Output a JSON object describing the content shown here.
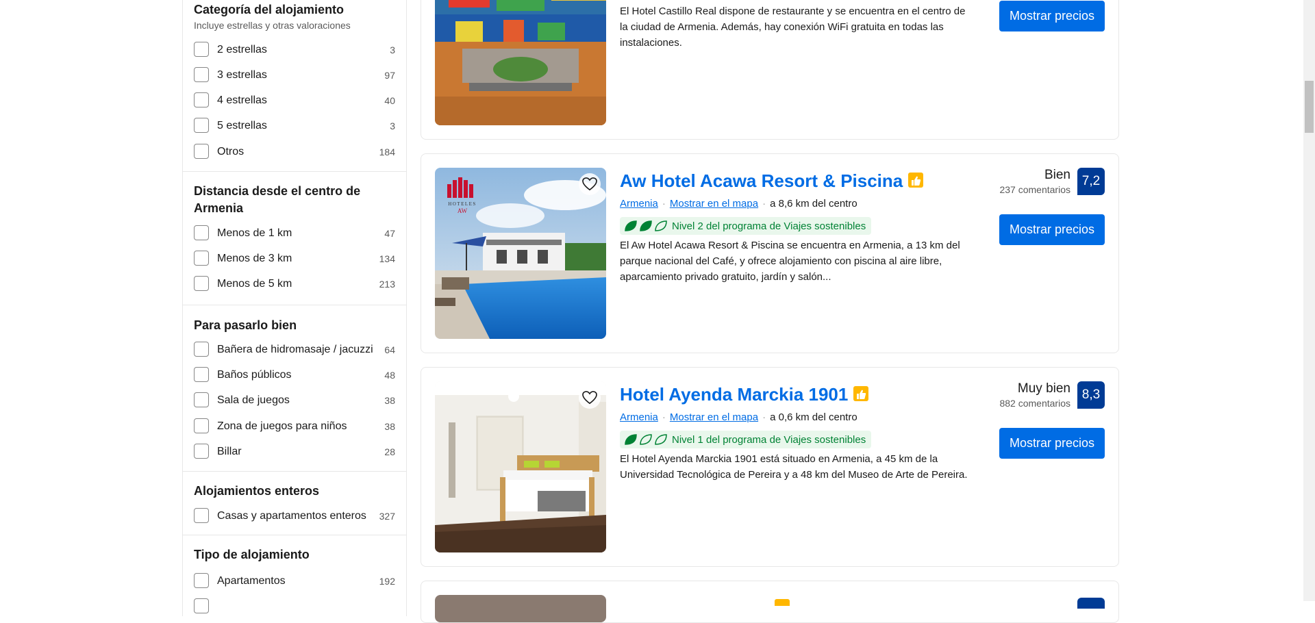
{
  "filters": {
    "category": {
      "title": "Categoría del alojamiento",
      "subtitle": "Incluye estrellas y otras valoraciones",
      "items": [
        {
          "label": "2 estrellas",
          "count": "3"
        },
        {
          "label": "3 estrellas",
          "count": "97"
        },
        {
          "label": "4 estrellas",
          "count": "40"
        },
        {
          "label": "5 estrellas",
          "count": "3"
        },
        {
          "label": "Otros",
          "count": "184"
        }
      ]
    },
    "distance": {
      "title": "Distancia desde el centro de Armenia",
      "items": [
        {
          "label": "Menos de 1 km",
          "count": "47"
        },
        {
          "label": "Menos de 3 km",
          "count": "134"
        },
        {
          "label": "Menos de 5 km",
          "count": "213"
        }
      ]
    },
    "fun": {
      "title": "Para pasarlo bien",
      "items": [
        {
          "label": "Bañera de hidromasaje / jacuzzi",
          "count": "64"
        },
        {
          "label": "Baños públicos",
          "count": "48"
        },
        {
          "label": "Sala de juegos",
          "count": "38"
        },
        {
          "label": "Zona de juegos para niños",
          "count": "38"
        },
        {
          "label": "Billar",
          "count": "28"
        }
      ]
    },
    "entire": {
      "title": "Alojamientos enteros",
      "items": [
        {
          "label": "Casas y apartamentos enteros",
          "count": "327"
        }
      ]
    },
    "type": {
      "title": "Tipo de alojamiento",
      "items": [
        {
          "label": "Apartamentos",
          "count": "192"
        }
      ]
    }
  },
  "results": [
    {
      "description": "El Hotel Castillo Real dispone de restaurante y se encuentra en el centro de la ciudad de Armenia. Además, hay conexión WiFi gratuita en todas las instalaciones.",
      "cta": "Mostrar precios"
    },
    {
      "name": "Aw Hotel Acawa Resort & Piscina",
      "city": "Armenia",
      "map_link": "Mostrar en el mapa",
      "distance": "a 8,6 km del centro",
      "sustainability": "Nivel 2 del programa de Viajes sostenibles",
      "sustainability_level": 2,
      "description": "El Aw Hotel Acawa Resort & Piscina se encuentra en Armenia, a 13 km del parque nacional del Café, y ofrece alojamiento con piscina al aire libre, aparcamiento privado gratuito, jardín y salón...",
      "review_word": "Bien",
      "review_count": "237 comentarios",
      "score": "7,2",
      "cta": "Mostrar precios",
      "logo_text": "HOTELES AW"
    },
    {
      "name": "Hotel Ayenda Marckia 1901",
      "city": "Armenia",
      "map_link": "Mostrar en el mapa",
      "distance": "a 0,6 km del centro",
      "sustainability": "Nivel 1 del programa de Viajes sostenibles",
      "sustainability_level": 1,
      "description": "El Hotel Ayenda Marckia 1901 está situado en Armenia, a 45 km de la Universidad Tecnológica de Pereira y a 48 km del Museo de Arte de Pereira.",
      "review_word": "Muy bien",
      "review_count": "882 comentarios",
      "score": "8,3",
      "cta": "Mostrar precios"
    }
  ],
  "colors": {
    "brand_blue": "#006ce4",
    "score_blue": "#003b95",
    "sustainable_green": "#008234",
    "thumb_yellow": "#ffb700"
  },
  "icons": [
    "heart-icon",
    "thumbs-up-icon",
    "leaf-icon"
  ]
}
